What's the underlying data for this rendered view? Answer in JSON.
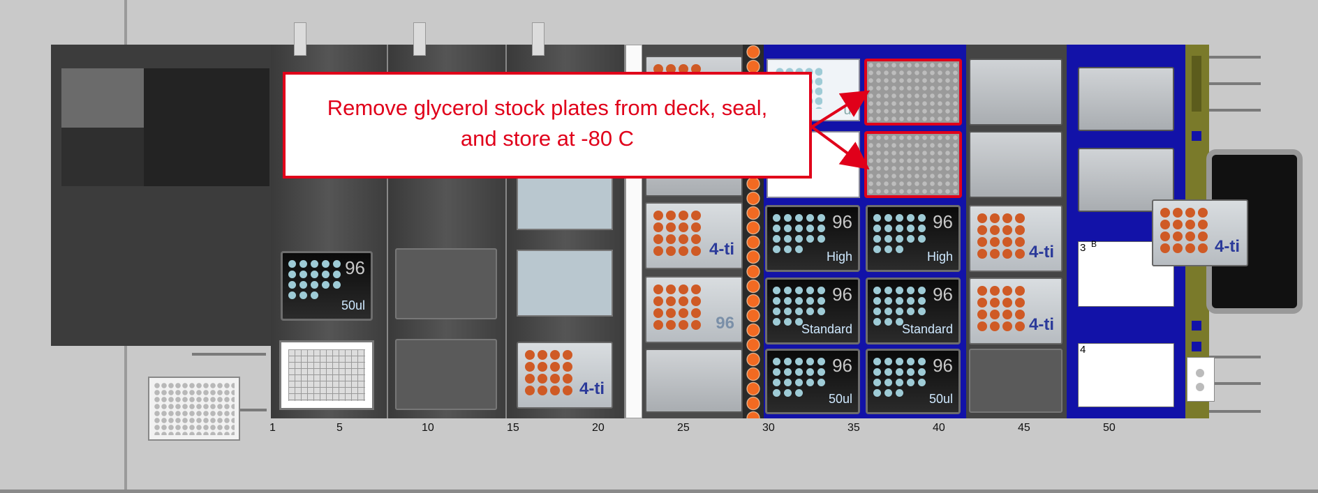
{
  "callout": {
    "line1": "Remove glycerol stock plates from deck, seal,",
    "line2": "and store at -80 C"
  },
  "ruler": [
    "1",
    "5",
    "10",
    "15",
    "20",
    "25",
    "30",
    "35",
    "40",
    "45",
    "50"
  ],
  "tips": {
    "t1": {
      "count": "96",
      "volume": "50ul"
    },
    "t2": {
      "count": "96",
      "volume": "High"
    },
    "t3": {
      "count": "96",
      "volume": "High"
    },
    "t4": {
      "count": "96",
      "volume": "Standard"
    },
    "t5": {
      "count": "96",
      "volume": "Standard"
    },
    "t6": {
      "count": "96",
      "volume": "50ul"
    },
    "t7": {
      "count": "96",
      "volume": "50ul"
    }
  },
  "plates": {
    "ti_label": "4-ti",
    "p96_label": "96",
    "partial_label": "ul"
  },
  "positions": {
    "p3": "3",
    "p4": "4",
    "pb": "B"
  },
  "colors": {
    "callout_red": "#e0001a",
    "carrier_blue": "#1212a8",
    "tip_orange": "#cf5a25"
  }
}
